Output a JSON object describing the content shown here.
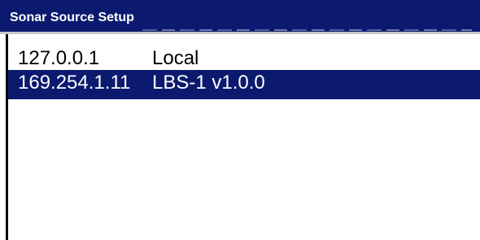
{
  "window": {
    "title": "Sonar Source Setup"
  },
  "sources": [
    {
      "address": "127.0.0.1",
      "name": "Local",
      "selected": false
    },
    {
      "address": "169.254.1.11",
      "name": "LBS-1 v1.0.0",
      "selected": true
    }
  ],
  "colors": {
    "titlebar": "#0b1a6e",
    "selection": "#0b1a6e",
    "background": "#ffffff",
    "text": "#000000",
    "selected_text": "#ffffff"
  }
}
